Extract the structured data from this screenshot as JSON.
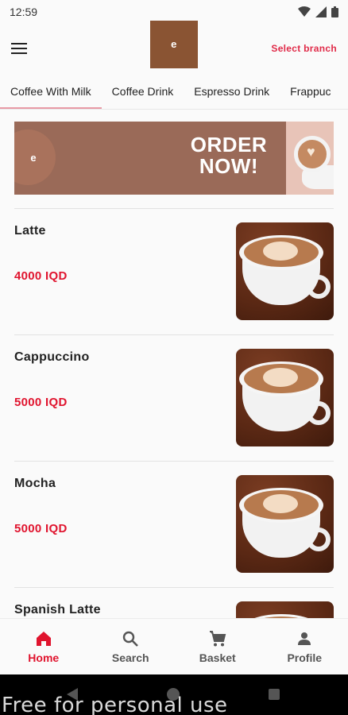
{
  "status_bar": {
    "time": "12:59",
    "icons": [
      "wifi-icon",
      "cellular-icon",
      "battery-icon"
    ]
  },
  "header": {
    "logo": {
      "mark": "e",
      "subtitle": ""
    },
    "select_branch": "Select branch"
  },
  "tabs": [
    {
      "label": "Coffee With Milk",
      "active": true
    },
    {
      "label": "Coffee Drink",
      "active": false
    },
    {
      "label": "Espresso Drink",
      "active": false
    },
    {
      "label": "Frappuc",
      "active": false
    }
  ],
  "banner": {
    "text_line1": "ORDER",
    "text_line2": "NOW!"
  },
  "items": [
    {
      "name": "Latte",
      "price": "4000 IQD"
    },
    {
      "name": "Cappuccino",
      "price": "5000 IQD"
    },
    {
      "name": "Mocha",
      "price": "5000 IQD"
    },
    {
      "name": "Spanish Latte",
      "price": ""
    }
  ],
  "bottom_nav": [
    {
      "label": "Home",
      "icon": "home-icon",
      "active": true
    },
    {
      "label": "Search",
      "icon": "search-icon",
      "active": false
    },
    {
      "label": "Basket",
      "icon": "cart-icon",
      "active": false
    },
    {
      "label": "Profile",
      "icon": "profile-icon",
      "active": false
    }
  ],
  "watermark": "Free for personal use",
  "colors": {
    "accent": "#e0142e",
    "brand": "#8a5433",
    "tab_indicator": "#e89aa6"
  }
}
